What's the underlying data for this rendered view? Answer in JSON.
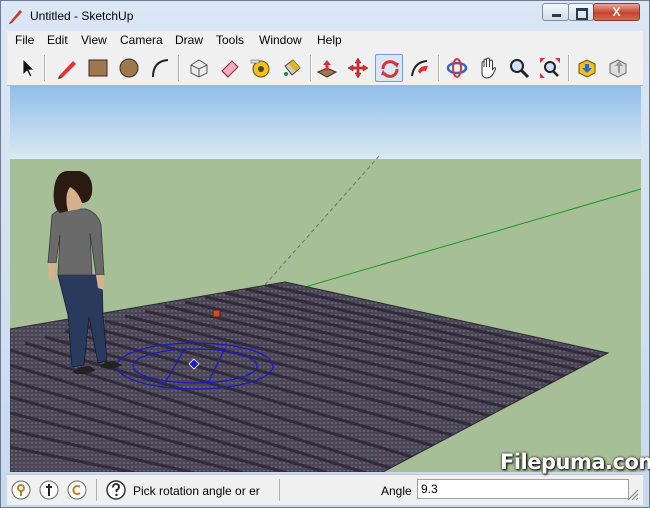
{
  "window": {
    "title": "Untitled - SketchUp",
    "close_label": "X"
  },
  "menubar": {
    "items": [
      "File",
      "Edit",
      "View",
      "Camera",
      "Draw",
      "Tools",
      "Window",
      "Help"
    ]
  },
  "toolbar": {
    "tools": [
      {
        "name": "select-tool",
        "icon": "cursor-arrow-icon"
      },
      {
        "name": "line-tool",
        "icon": "pencil-icon"
      },
      {
        "name": "rectangle-tool",
        "icon": "rectangle-icon"
      },
      {
        "name": "circle-tool",
        "icon": "circle-icon"
      },
      {
        "name": "arc-tool",
        "icon": "arc-icon"
      },
      {
        "name": "make-component-tool",
        "icon": "component-box-icon"
      },
      {
        "name": "eraser-tool",
        "icon": "eraser-icon"
      },
      {
        "name": "tape-measure-tool",
        "icon": "tape-measure-icon"
      },
      {
        "name": "paint-bucket-tool",
        "icon": "paint-bucket-icon"
      },
      {
        "name": "push-pull-tool",
        "icon": "push-pull-icon"
      },
      {
        "name": "move-tool",
        "icon": "move-arrows-icon"
      },
      {
        "name": "rotate-tool",
        "icon": "rotate-icon",
        "active": true
      },
      {
        "name": "follow-me-tool",
        "icon": "follow-me-icon"
      },
      {
        "name": "orbit-tool",
        "icon": "orbit-icon"
      },
      {
        "name": "pan-tool",
        "icon": "hand-icon"
      },
      {
        "name": "zoom-tool",
        "icon": "magnifier-icon"
      },
      {
        "name": "zoom-extents-tool",
        "icon": "zoom-extents-icon"
      },
      {
        "name": "get-models-tool",
        "icon": "get-models-icon"
      },
      {
        "name": "share-model-tool",
        "icon": "share-model-icon"
      }
    ]
  },
  "viewport": {
    "colors": {
      "sky": "#b4d2ee",
      "ground": "#a6bf96",
      "green_axis": "#1a9a1a",
      "red_axis": "#c81e1e",
      "protractor": "#1a1ac8",
      "surface": "#4a4656"
    }
  },
  "statusbar": {
    "icons": [
      "geo-location-icon",
      "credits-icon",
      "copyright-icon",
      "help-icon"
    ],
    "status_text": "Pick rotation angle or er",
    "vcb_label": "Angle",
    "vcb_value": "9.3"
  },
  "watermark": "Filepuma.com"
}
